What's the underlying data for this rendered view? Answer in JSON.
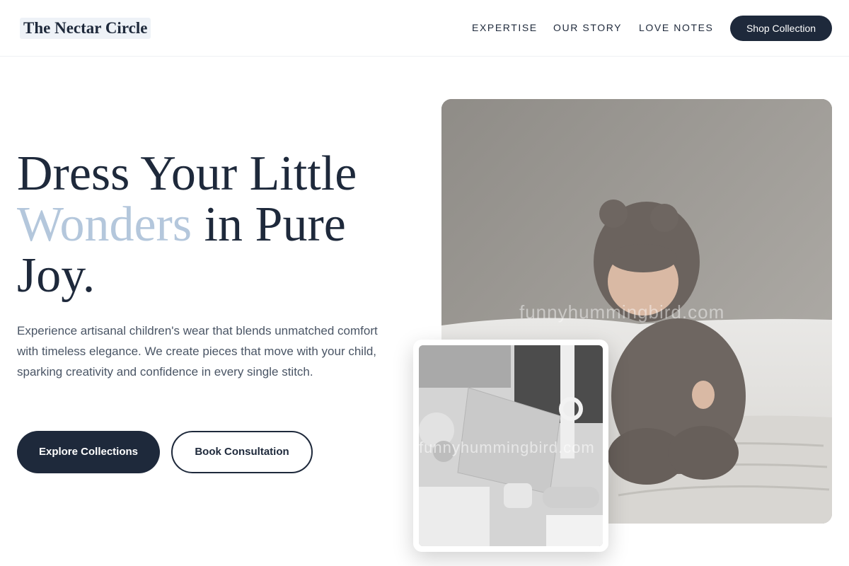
{
  "header": {
    "logo": "The Nectar Circle",
    "nav": [
      "EXPERTISE",
      "OUR STORY",
      "LOVE NOTES"
    ],
    "cta": "Shop Collection"
  },
  "hero": {
    "headline_line1": "Dress Your Little",
    "headline_accent": "Wonders",
    "headline_line2_rest": " in Pure",
    "headline_line3": "Joy.",
    "description": "Experience artisanal children's wear that blends unmatched comfort with timeless elegance. We create pieces that move with your child, sparking creativity and confidence in every single stitch.",
    "primary_button": "Explore Collections",
    "secondary_button": "Book Consultation"
  },
  "images": {
    "main_watermark": "funnyhummingbird.com",
    "inset_watermark": "funnyhummingbird.com"
  },
  "colors": {
    "primary": "#1e293b",
    "accent": "#b4c7dc",
    "body_text": "#4a5565"
  }
}
